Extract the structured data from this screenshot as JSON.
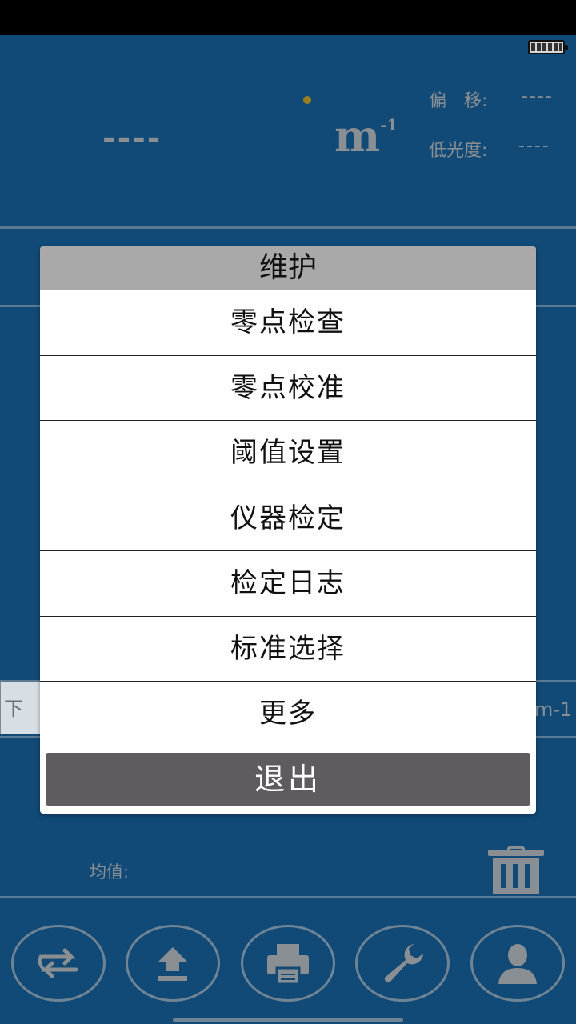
{
  "header": {
    "reading": "----",
    "unit": "m",
    "unit_exp": "-1",
    "offset_label": "偏　移:",
    "offset_value": "----",
    "low_light_label": "低光度:",
    "low_light_value": "----"
  },
  "side": {
    "left_label": "下一",
    "right_label": "m-1"
  },
  "stats": {
    "average_label": "均值:"
  },
  "maintenance_dialog": {
    "title": "维护",
    "items": [
      {
        "label": "零点检查"
      },
      {
        "label": "零点校准"
      },
      {
        "label": "阈值设置"
      },
      {
        "label": "仪器检定"
      },
      {
        "label": "检定日志"
      },
      {
        "label": "标准选择"
      },
      {
        "label": "更多"
      }
    ],
    "exit_label": "退出"
  },
  "nav": {
    "buttons": [
      {
        "icon": "swap-icon"
      },
      {
        "icon": "upload-icon"
      },
      {
        "icon": "print-icon"
      },
      {
        "icon": "wrench-icon"
      },
      {
        "icon": "user-icon"
      }
    ]
  },
  "colors": {
    "background": "#114a76",
    "muted_text": "#8a8f93",
    "dialog_title_bg": "#a9a9a9",
    "exit_button_bg": "#5e5c5e"
  }
}
